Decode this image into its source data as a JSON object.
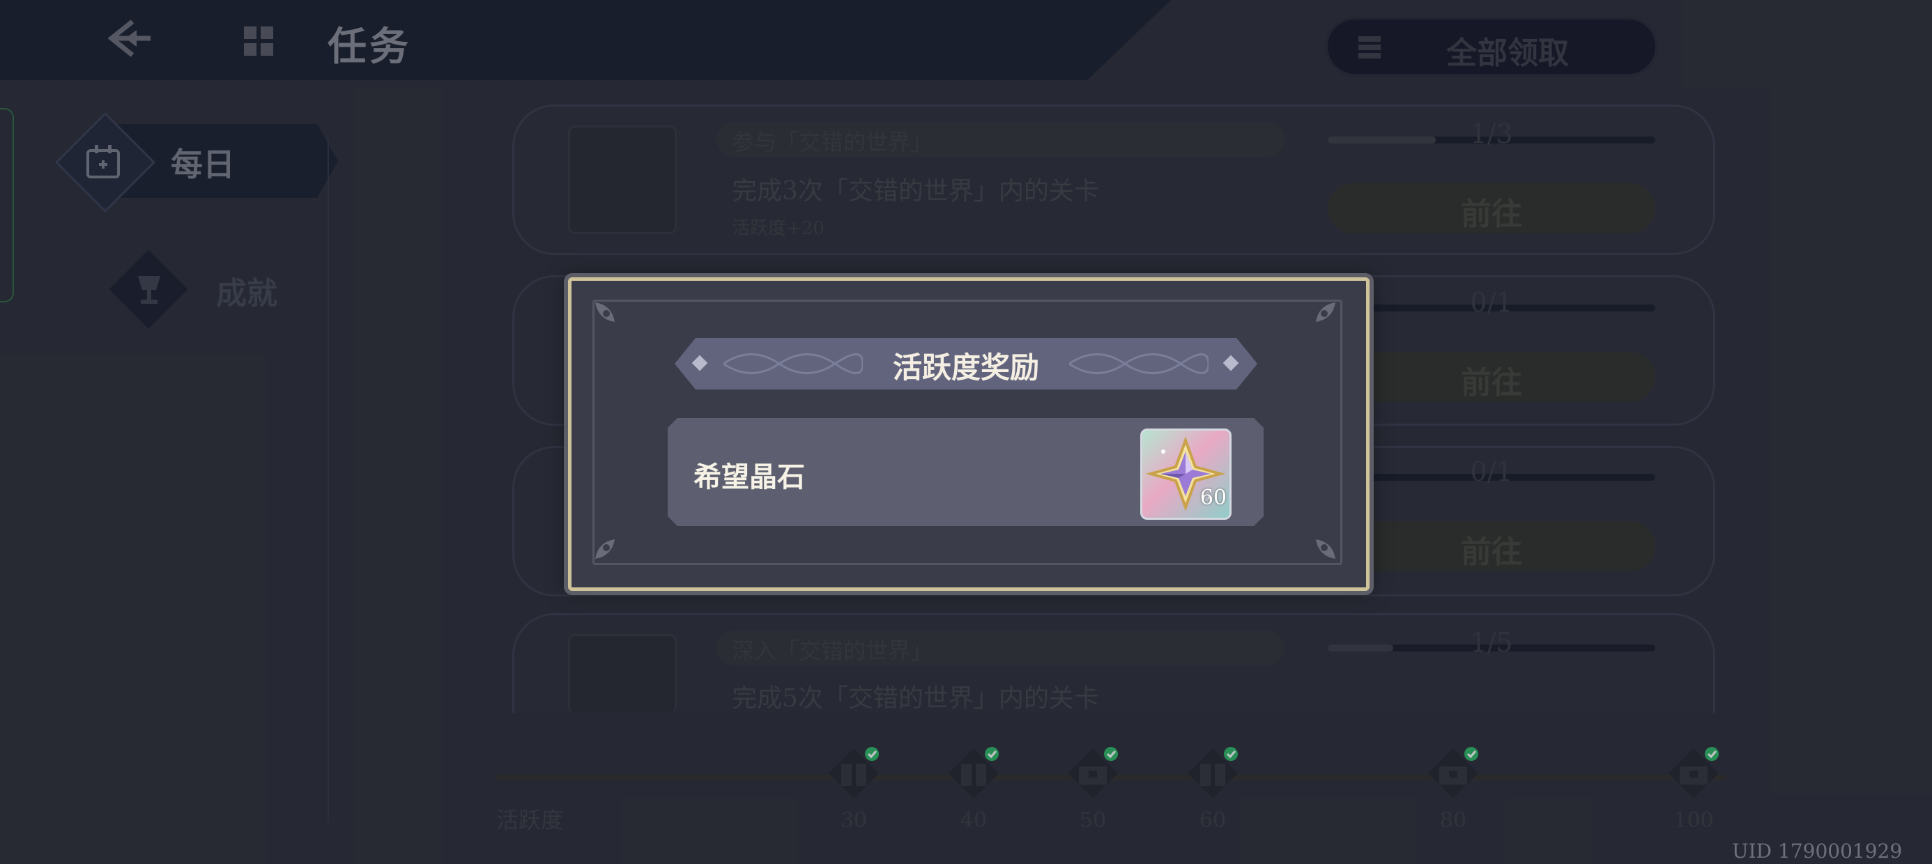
{
  "header": {
    "title": "任务",
    "claim_all_label": "全部领取"
  },
  "sidebar": {
    "tabs": [
      {
        "label": "每日",
        "selected": true
      },
      {
        "label": "成就",
        "selected": false
      }
    ]
  },
  "tasks": [
    {
      "tag": "参与「交错的世界」",
      "desc": "完成3次「交错的世界」内的关卡",
      "points": "活跃度+20",
      "progress": "1/3",
      "progress_fraction": 0.33,
      "button": "前往"
    },
    {
      "progress": "0/1",
      "progress_fraction": 0,
      "button": "前往"
    },
    {
      "progress": "0/1",
      "progress_fraction": 0,
      "button": "前往"
    },
    {
      "tag": "深入「交错的世界」",
      "desc": "完成5次「交错的世界」内的关卡",
      "progress": "1/5",
      "progress_fraction": 0.2
    }
  ],
  "activity": {
    "label": "活跃度",
    "milestones": [
      "30",
      "40",
      "50",
      "60",
      "80",
      "100"
    ]
  },
  "uid": "UID 1790001929",
  "modal": {
    "title": "活跃度奖励",
    "reward": {
      "name": "希望晶石",
      "quantity": "60",
      "icon": "crystal-icon"
    }
  },
  "colors": {
    "modal_border": "#cfc39a",
    "modal_bg": "#3b3c4a",
    "title_bar": "#62647e",
    "claimed_check": "#2fb86a"
  }
}
